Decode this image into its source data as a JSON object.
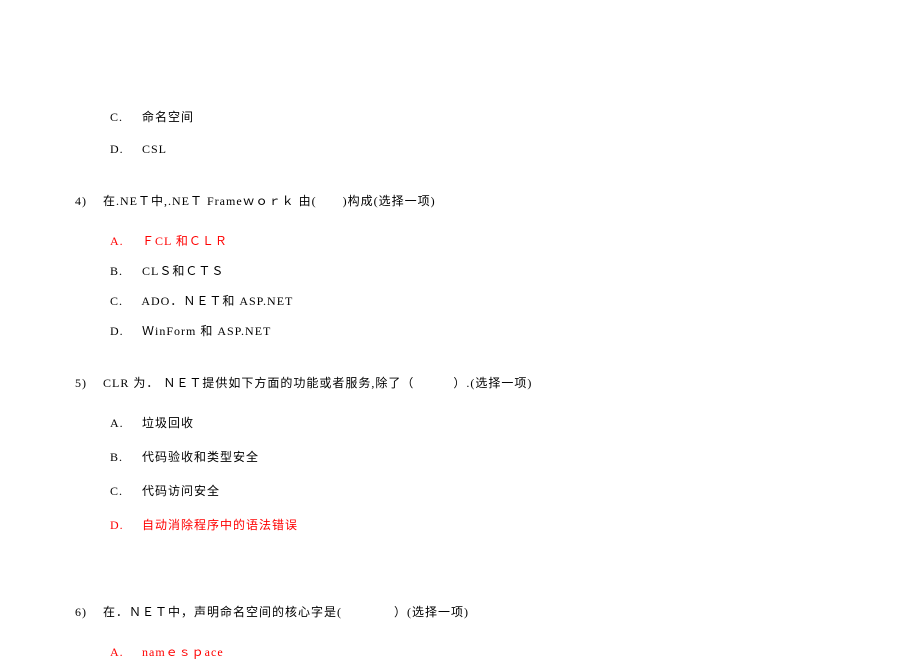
{
  "orphan_options": {
    "c": {
      "label": "C.",
      "text": "命名空间"
    },
    "d": {
      "label": "D.",
      "text": "CSL"
    }
  },
  "q4": {
    "num": "4)",
    "text": "在.NEＴ中,.NEＴ Frameｗｏｒｋ 由(　　)构成(选择一项)",
    "options": {
      "a": {
        "label": "A.",
        "text": "ＦCL 和ＣＬＲ"
      },
      "b": {
        "label": "B.",
        "text": "CLＳ和ＣＴＳ"
      },
      "c": {
        "label": "C.",
        "text": "ADO．ＮＥＴ和 ASP.NET"
      },
      "d": {
        "label": "D.",
        "text": "ＷinForm 和 ASP.NET"
      }
    }
  },
  "q5": {
    "num": "5)",
    "text": "CLR 为． ＮＥＴ提供如下方面的功能或者服务,除了（　　　）.(选择一项)",
    "options": {
      "a": {
        "label": "A.",
        "text": "垃圾回收"
      },
      "b": {
        "label": "B.",
        "text": "代码验收和类型安全"
      },
      "c": {
        "label": "C.",
        "text": "代码访问安全"
      },
      "d": {
        "label": "D.",
        "text": "自动消除程序中的语法错误"
      }
    }
  },
  "q6": {
    "num": "6)",
    "text": "在．ＮＥＴ中，声明命名空间的核心字是(　　　　）(选择一项)",
    "options": {
      "a": {
        "label": "A.",
        "text": "namｅｓｐace"
      }
    }
  }
}
